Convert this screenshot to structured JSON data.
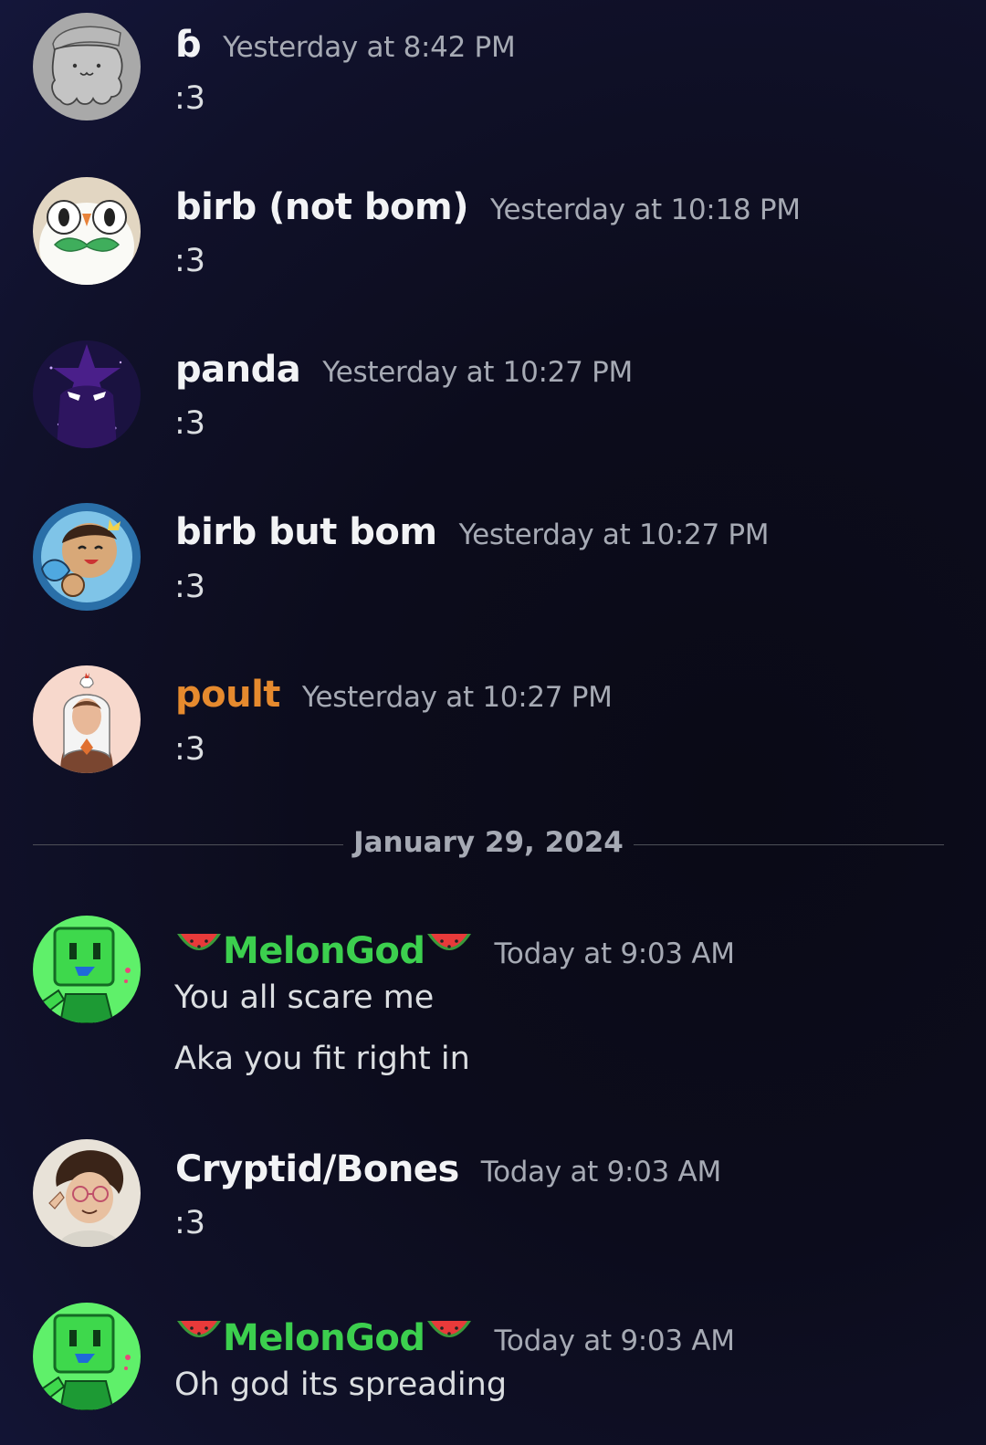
{
  "colors": {
    "background": "#0c0c1c",
    "username_default": "#f2f3f5",
    "username_melongod": "#3ccf4e",
    "username_poult": "#e68a2e",
    "timestamp": "#a6aab4",
    "message_text": "#dbdee1"
  },
  "messages": [
    {
      "username": "ɓ",
      "timestamp": "Yesterday at 8:42 PM",
      "lines": [
        ":3"
      ],
      "avatar_icon": "autism-hat-creature-avatar"
    },
    {
      "username": "birb (not bom)",
      "timestamp": "Yesterday at 10:18 PM",
      "lines": [
        ":3"
      ],
      "avatar_icon": "owl-avatar"
    },
    {
      "username": "panda",
      "timestamp": "Yesterday at 10:27 PM",
      "lines": [
        ":3"
      ],
      "avatar_icon": "purple-star-creature-avatar"
    },
    {
      "username": "birb but bom",
      "timestamp": "Yesterday at 10:27 PM",
      "lines": [
        ":3"
      ],
      "avatar_icon": "crowned-character-avatar"
    },
    {
      "username": "poult",
      "timestamp": "Yesterday at 10:27 PM",
      "lines": [
        ":3"
      ],
      "avatar_icon": "chicken-hat-person-avatar"
    }
  ],
  "date_divider": "January 29, 2024",
  "messages_today": [
    {
      "username": "MelonGod",
      "timestamp": "Today at 9:03 AM",
      "lines": [
        "You all scare me",
        "Aka you fit right in"
      ],
      "avatar_icon": "green-robot-avatar",
      "name_decoration_icon": "watermelon-icon"
    },
    {
      "username": "Cryptid/Bones",
      "timestamp": "Today at 9:03 AM",
      "lines": [
        ":3"
      ],
      "avatar_icon": "glasses-person-avatar"
    },
    {
      "username": "MelonGod",
      "timestamp": "Today at 9:03 AM",
      "lines": [
        "Oh god its spreading"
      ],
      "avatar_icon": "green-robot-avatar",
      "name_decoration_icon": "watermelon-icon"
    }
  ]
}
